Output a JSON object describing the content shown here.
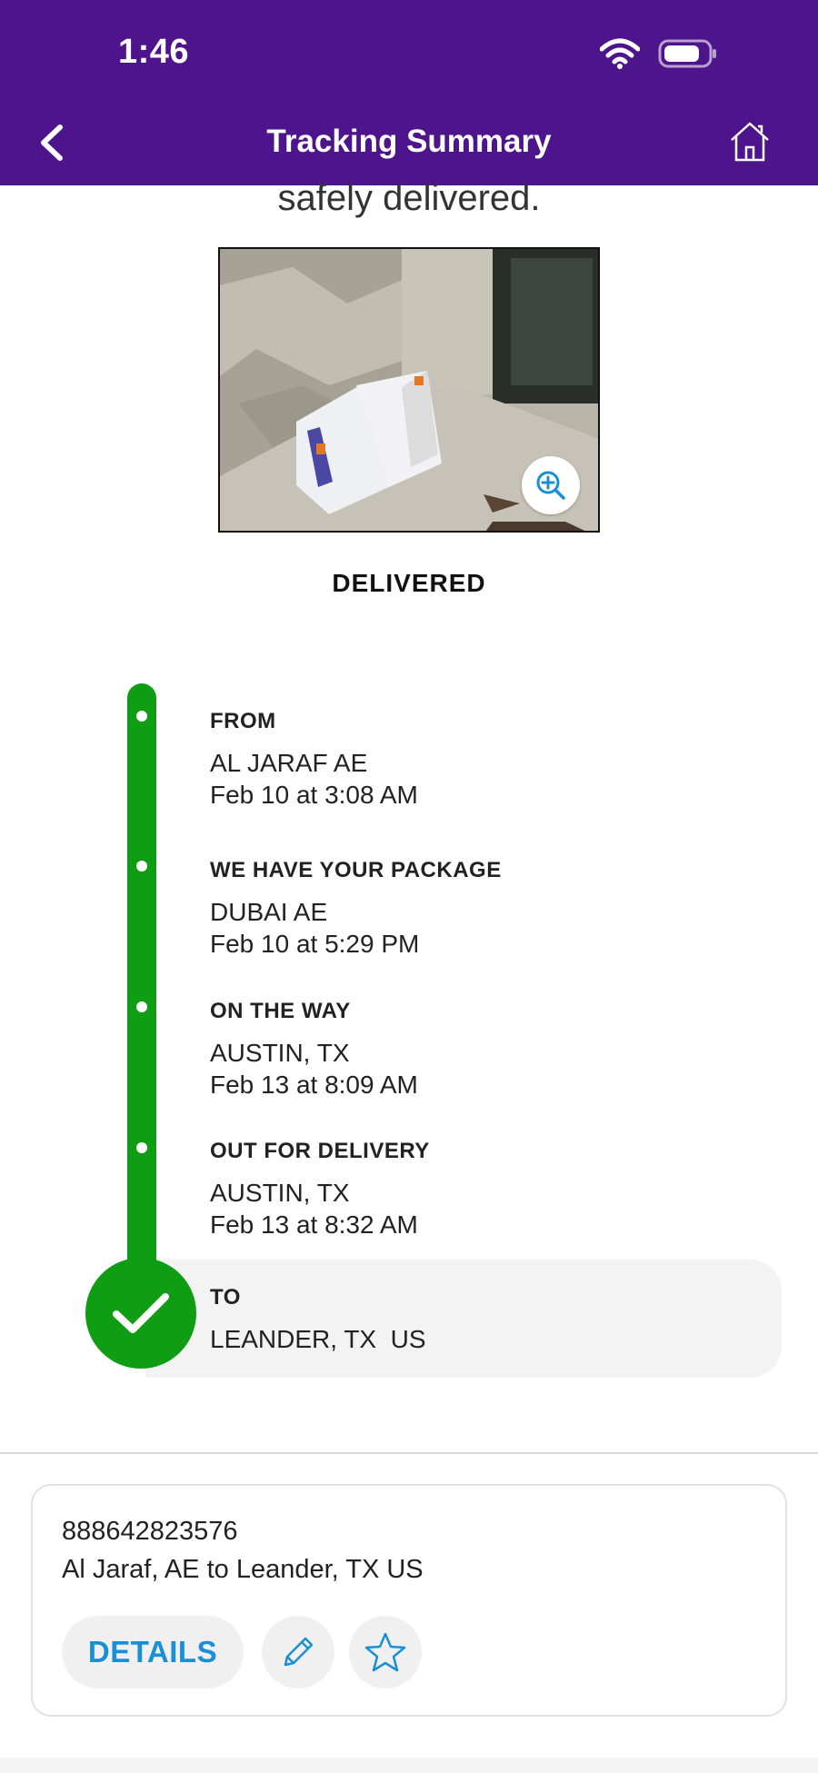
{
  "status_bar": {
    "time": "1:46"
  },
  "nav": {
    "title": "Tracking Summary"
  },
  "content": {
    "headline": "safely delivered.",
    "status": "DELIVERED"
  },
  "timeline": [
    {
      "title": "FROM",
      "location": "AL JARAF AE",
      "time": "Feb 10 at 3:08 AM"
    },
    {
      "title": "WE HAVE YOUR PACKAGE",
      "location": "DUBAI AE",
      "time": "Feb 10 at 5:29 PM"
    },
    {
      "title": "ON THE WAY",
      "location": "AUSTIN, TX",
      "time": "Feb 13 at 8:09 AM"
    },
    {
      "title": "OUT FOR DELIVERY",
      "location": "AUSTIN, TX",
      "time": "Feb 13 at 8:32 AM"
    },
    {
      "title": "TO",
      "location": "LEANDER, TX  US"
    }
  ],
  "card": {
    "tracking_number": "888642823576",
    "route": "Al Jaraf, AE to Leander, TX US",
    "details_label": "DETAILS"
  },
  "colors": {
    "header": "#4d148c",
    "timeline_green": "#0f9d13",
    "link_blue": "#1a8fd6"
  }
}
